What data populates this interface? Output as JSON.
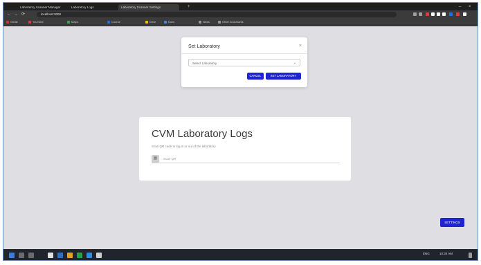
{
  "browser": {
    "tabs": [
      {
        "label": "Laboratory Scanner Manager",
        "active": false
      },
      {
        "label": "Laboratory Logs",
        "active": false
      },
      {
        "label": "Laboratory Scanner Settings",
        "active": true
      }
    ],
    "new_tab": "+",
    "address": "localhost:3000",
    "bookmarks": [
      {
        "label": "Gmail",
        "color": "#d93025"
      },
      {
        "label": "YouTube",
        "color": "#e53935"
      },
      {
        "label": "Maps",
        "color": "#34a853"
      },
      {
        "label": "Course",
        "color": "#1a73e8"
      },
      {
        "label": "Drive",
        "color": "#fbbc04"
      },
      {
        "label": "Docs",
        "color": "#4285f4"
      },
      {
        "label": "News",
        "color": "#999999"
      },
      {
        "label": "Other bookmarks",
        "color": "#999999"
      }
    ],
    "extension_colors": [
      "#9e9e9e",
      "#9e9e9e",
      "#e53935",
      "#ffffff",
      "#ffffff",
      "#ffffff",
      "#1a73e8",
      "#e53935",
      "#ffffff"
    ]
  },
  "modal": {
    "title": "Set Laboratory",
    "close_icon": "×",
    "select_placeholder": "Select Laboratory",
    "select_chevron": "⌄",
    "cancel_label": "CANCEL",
    "submit_label": "SET LABORATORY"
  },
  "card": {
    "title": "CVM Laboratory Logs",
    "subtitle": "Scan QR code to log in or out of the laboratory",
    "input_placeholder": "Scan QR",
    "input_icon": "▦"
  },
  "settings_button_label": "SETTINGS",
  "taskbar": {
    "tray_text": "ENG",
    "time": "10:30 AM"
  }
}
